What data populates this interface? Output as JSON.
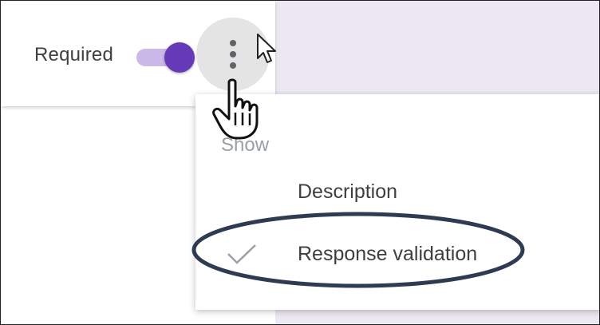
{
  "card": {
    "required_label": "Required",
    "required_toggle_on": true
  },
  "more_button": {
    "icon": "more-vert-icon"
  },
  "menu": {
    "header": "Show",
    "items": [
      {
        "label": "Description",
        "checked": false
      },
      {
        "label": "Response validation",
        "checked": true,
        "icon": "check-icon"
      }
    ]
  },
  "annotation": {
    "highlight_color": "#2f3b52",
    "highlighted_item": "Response validation"
  },
  "colors": {
    "accent": "#673ab7",
    "accent_track": "#c9b8e8",
    "background_panel": "#ece8f3",
    "text": "#3c4043",
    "muted_text": "#9aa0a6"
  },
  "cursors": {
    "arrow": "arrow-cursor-icon",
    "hand": "hand-pointer-cursor-icon"
  }
}
